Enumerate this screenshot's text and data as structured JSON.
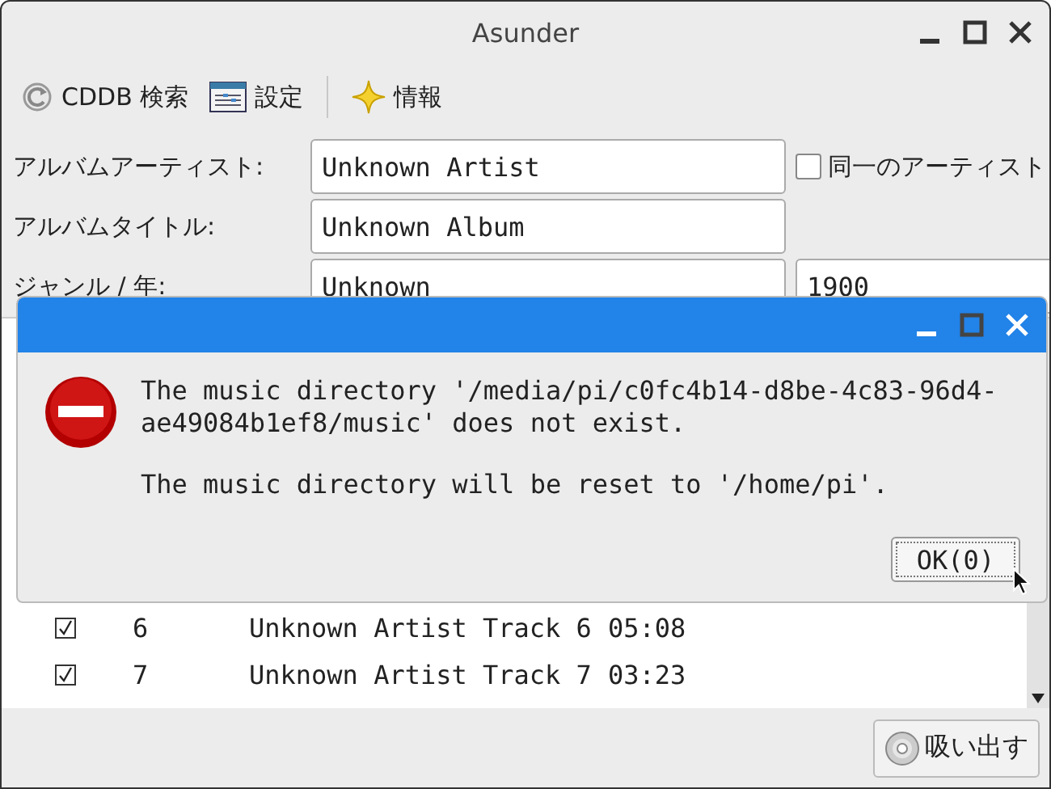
{
  "window": {
    "title": "Asunder"
  },
  "toolbar": {
    "cddb": "CDDB 検索",
    "preferences": "設定",
    "about": "情報"
  },
  "form": {
    "artist_label": "アルバムアーティスト:",
    "artist": "Unknown Artist",
    "same_artist": {
      "label": "同一のアーティスト",
      "checked": false
    },
    "title_label": "アルバムタイトル:",
    "title": "Unknown Album",
    "genre_label": "ジャンル / 年:",
    "genre": "Unknown",
    "year": "1900"
  },
  "tracks": [
    {
      "checked": true,
      "number": "6",
      "title": "Unknown Artist Track 6",
      "time": "05:08"
    },
    {
      "checked": true,
      "number": "7",
      "title": "Unknown Artist Track 7",
      "time": "03:23"
    }
  ],
  "rip_button": "吸い出す",
  "dialog": {
    "message": "The music directory '/media/pi/c0fc4b14-d8be-4c83-96d4-ae49084b1ef8/music' does not exist.",
    "detail": "The music directory will be reset to '/home/pi'.",
    "ok_button": "OK(0)"
  }
}
